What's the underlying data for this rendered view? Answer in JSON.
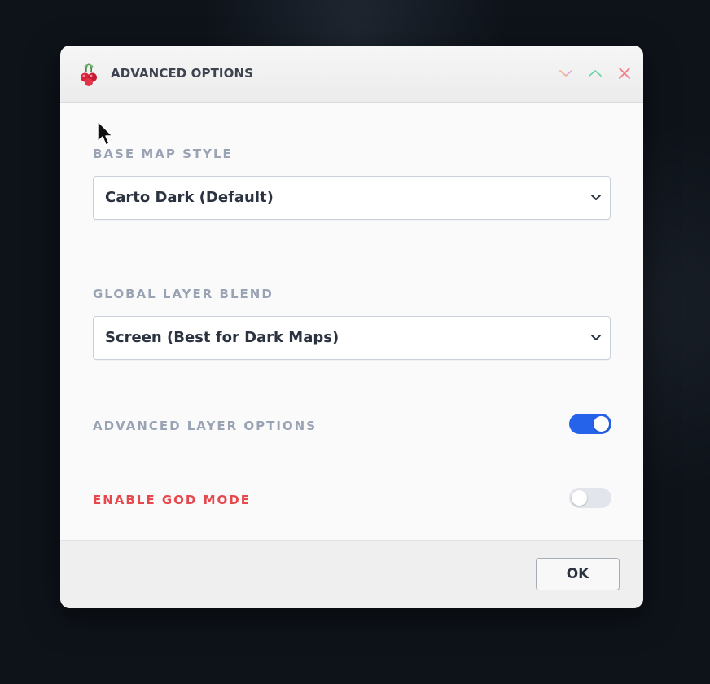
{
  "window": {
    "title": "ADVANCED OPTIONS",
    "app_icon": "cherry-icon",
    "controls": [
      "minimize-icon",
      "maximize-icon",
      "close-icon"
    ],
    "control_colors": {
      "minimize": "#e8a6d8",
      "maximize": "#6bd6a0",
      "close": "#f07c8c"
    }
  },
  "base_map": {
    "label": "BASE MAP STYLE",
    "value": "Carto Dark (Default)"
  },
  "layer_blend": {
    "label": "GLOBAL LAYER BLEND",
    "value": "Screen (Best for Dark Maps)"
  },
  "advanced_layers": {
    "label": "ADVANCED LAYER OPTIONS",
    "enabled": true
  },
  "god_mode": {
    "label": "ENABLE GOD MODE",
    "enabled": false,
    "label_color": "#e5484d"
  },
  "footer": {
    "ok_label": "OK"
  },
  "colors": {
    "accent": "#2563eb",
    "label": "#99a3b4",
    "danger": "#e5484d"
  }
}
